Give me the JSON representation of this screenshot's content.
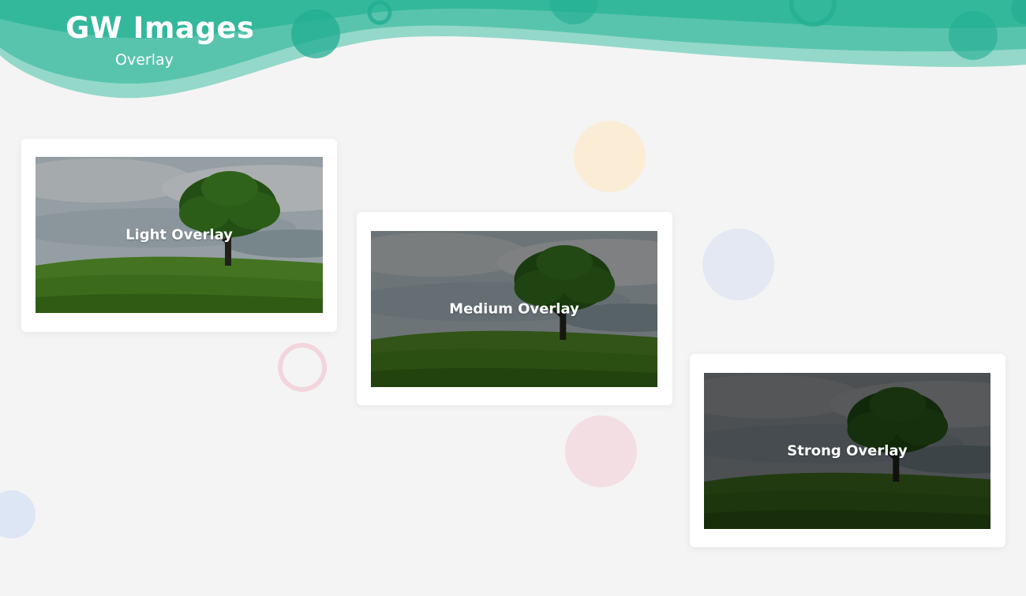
{
  "header": {
    "title": "GW Images",
    "subtitle": "Overlay",
    "accent_color": "#2bb59a"
  },
  "cards": [
    {
      "label": "Light Overlay",
      "overlay_opacity": 0.25
    },
    {
      "label": "Medium Overlay",
      "overlay_opacity": 0.45
    },
    {
      "label": "Strong Overlay",
      "overlay_opacity": 0.62
    }
  ],
  "decorations": {
    "circle_colors": [
      "#fbecd6",
      "#e4e8f2",
      "#f3d6dd",
      "#dde6f5"
    ]
  }
}
